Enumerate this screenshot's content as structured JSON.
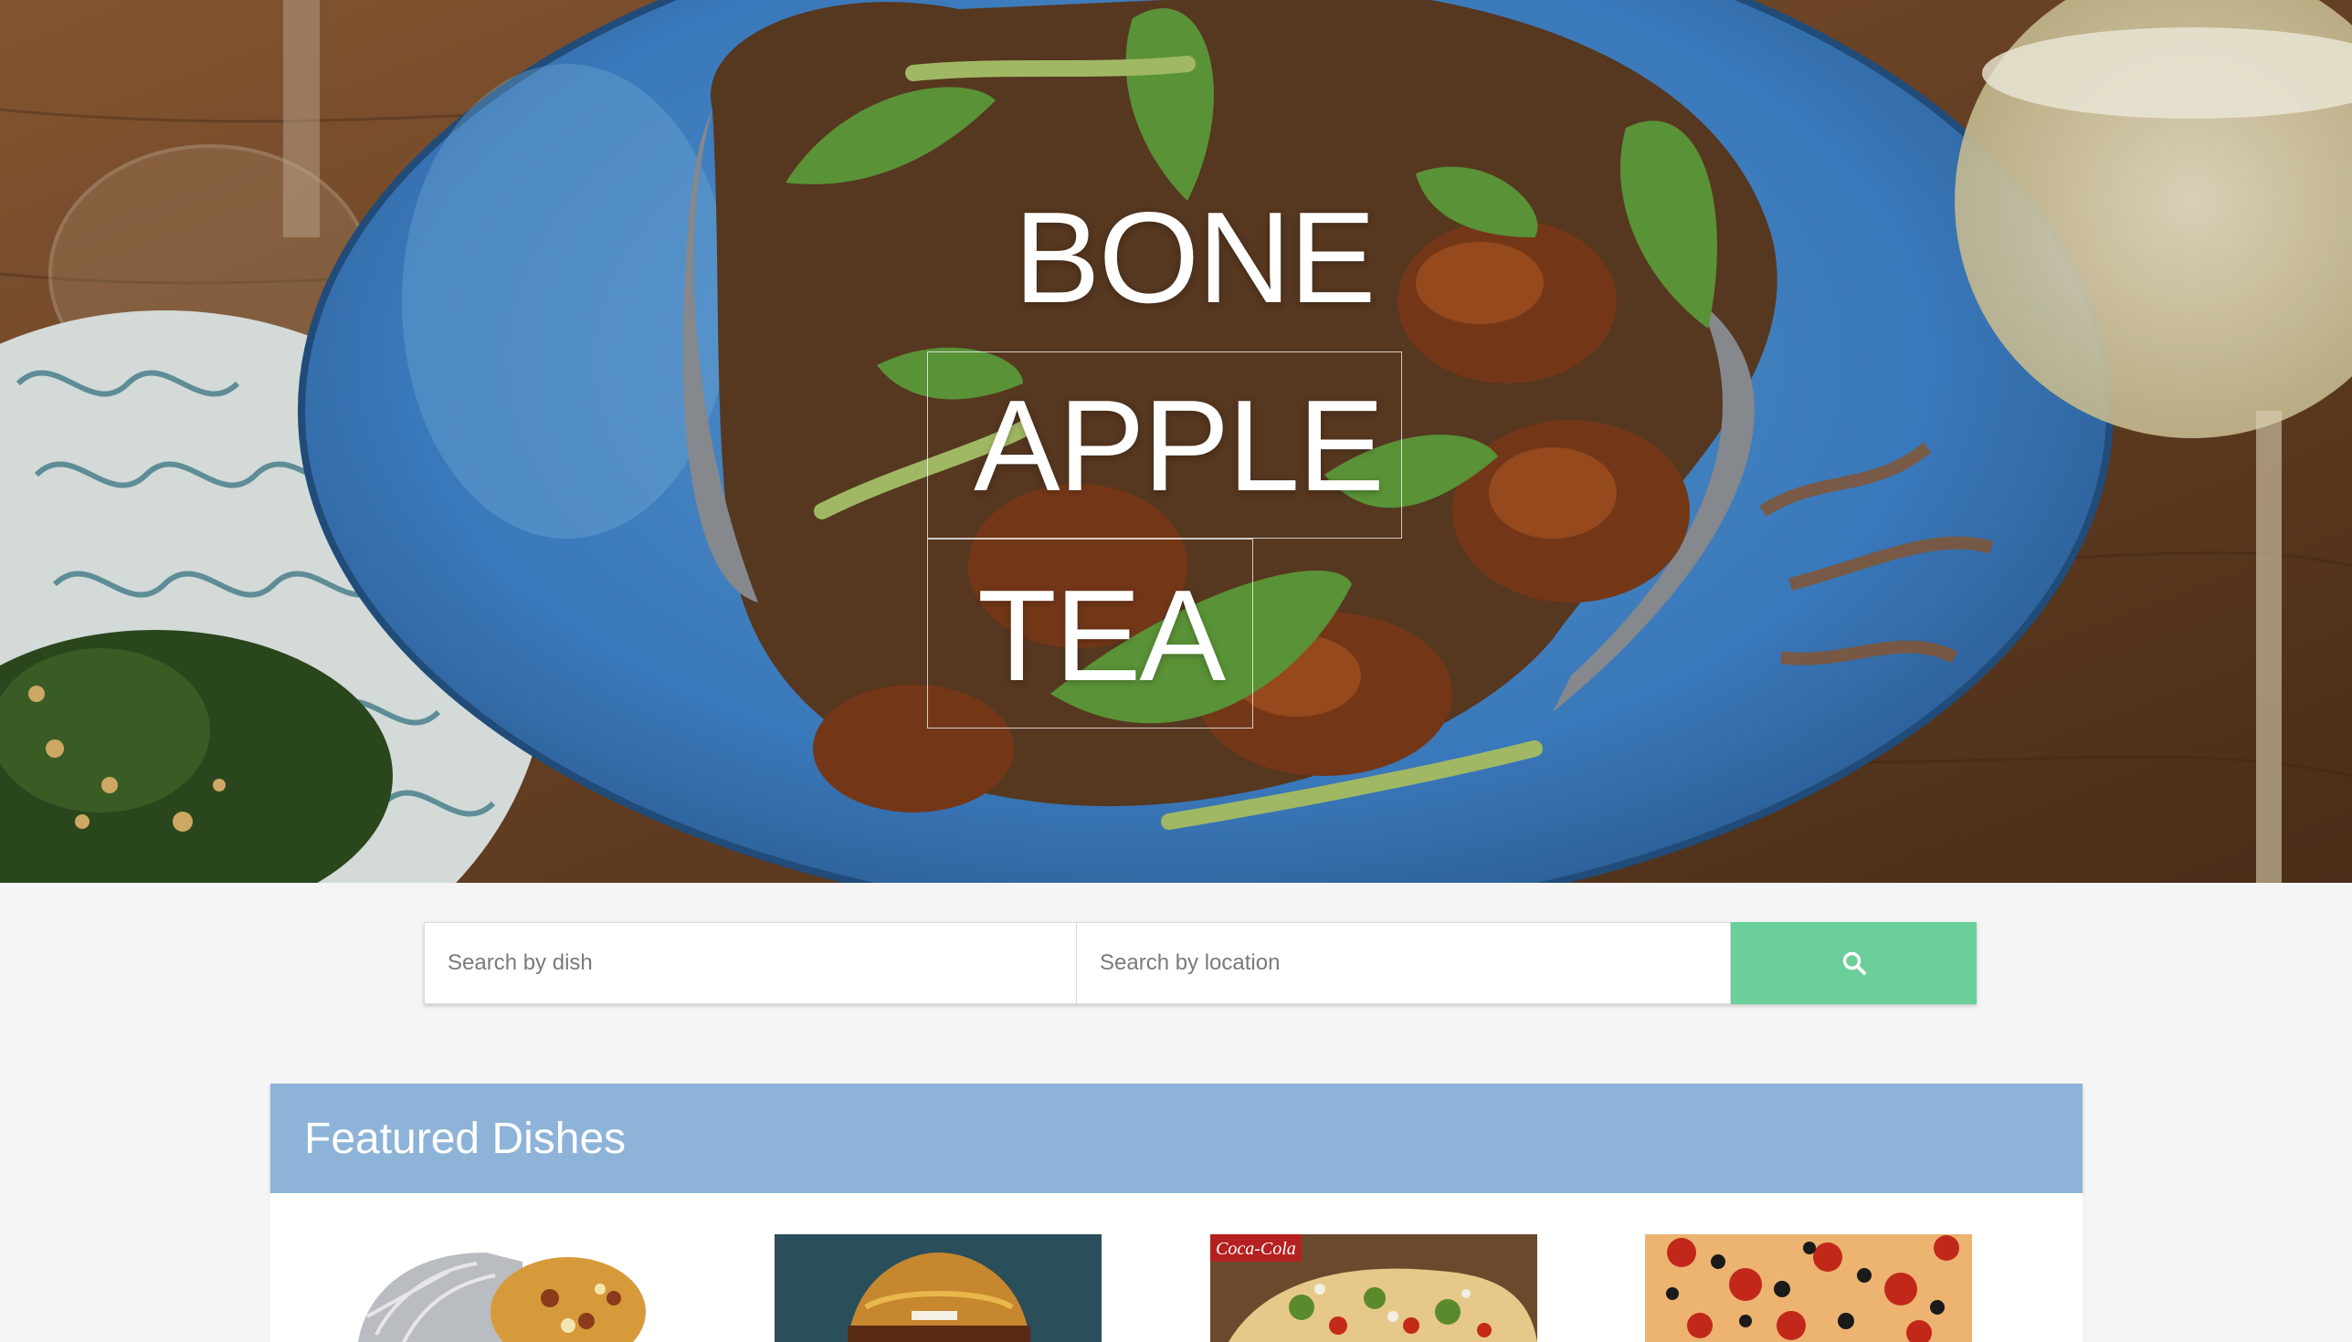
{
  "hero": {
    "title_words": [
      "BONE",
      "APPLE",
      "TEA"
    ],
    "image": "plated-food-photo"
  },
  "search": {
    "dish_placeholder": "Search by dish",
    "location_placeholder": "Search by location",
    "button_icon": "search-icon"
  },
  "featured": {
    "title": "Featured Dishes",
    "dishes": [
      {
        "image": "burrito-photo"
      },
      {
        "image": "burger-photo"
      },
      {
        "image": "tacos-photo"
      },
      {
        "image": "pizza-photo"
      }
    ]
  },
  "colors": {
    "search_button": "#6acf98",
    "featured_header": "#8db3d8",
    "page_background": "#f4f5f4"
  }
}
